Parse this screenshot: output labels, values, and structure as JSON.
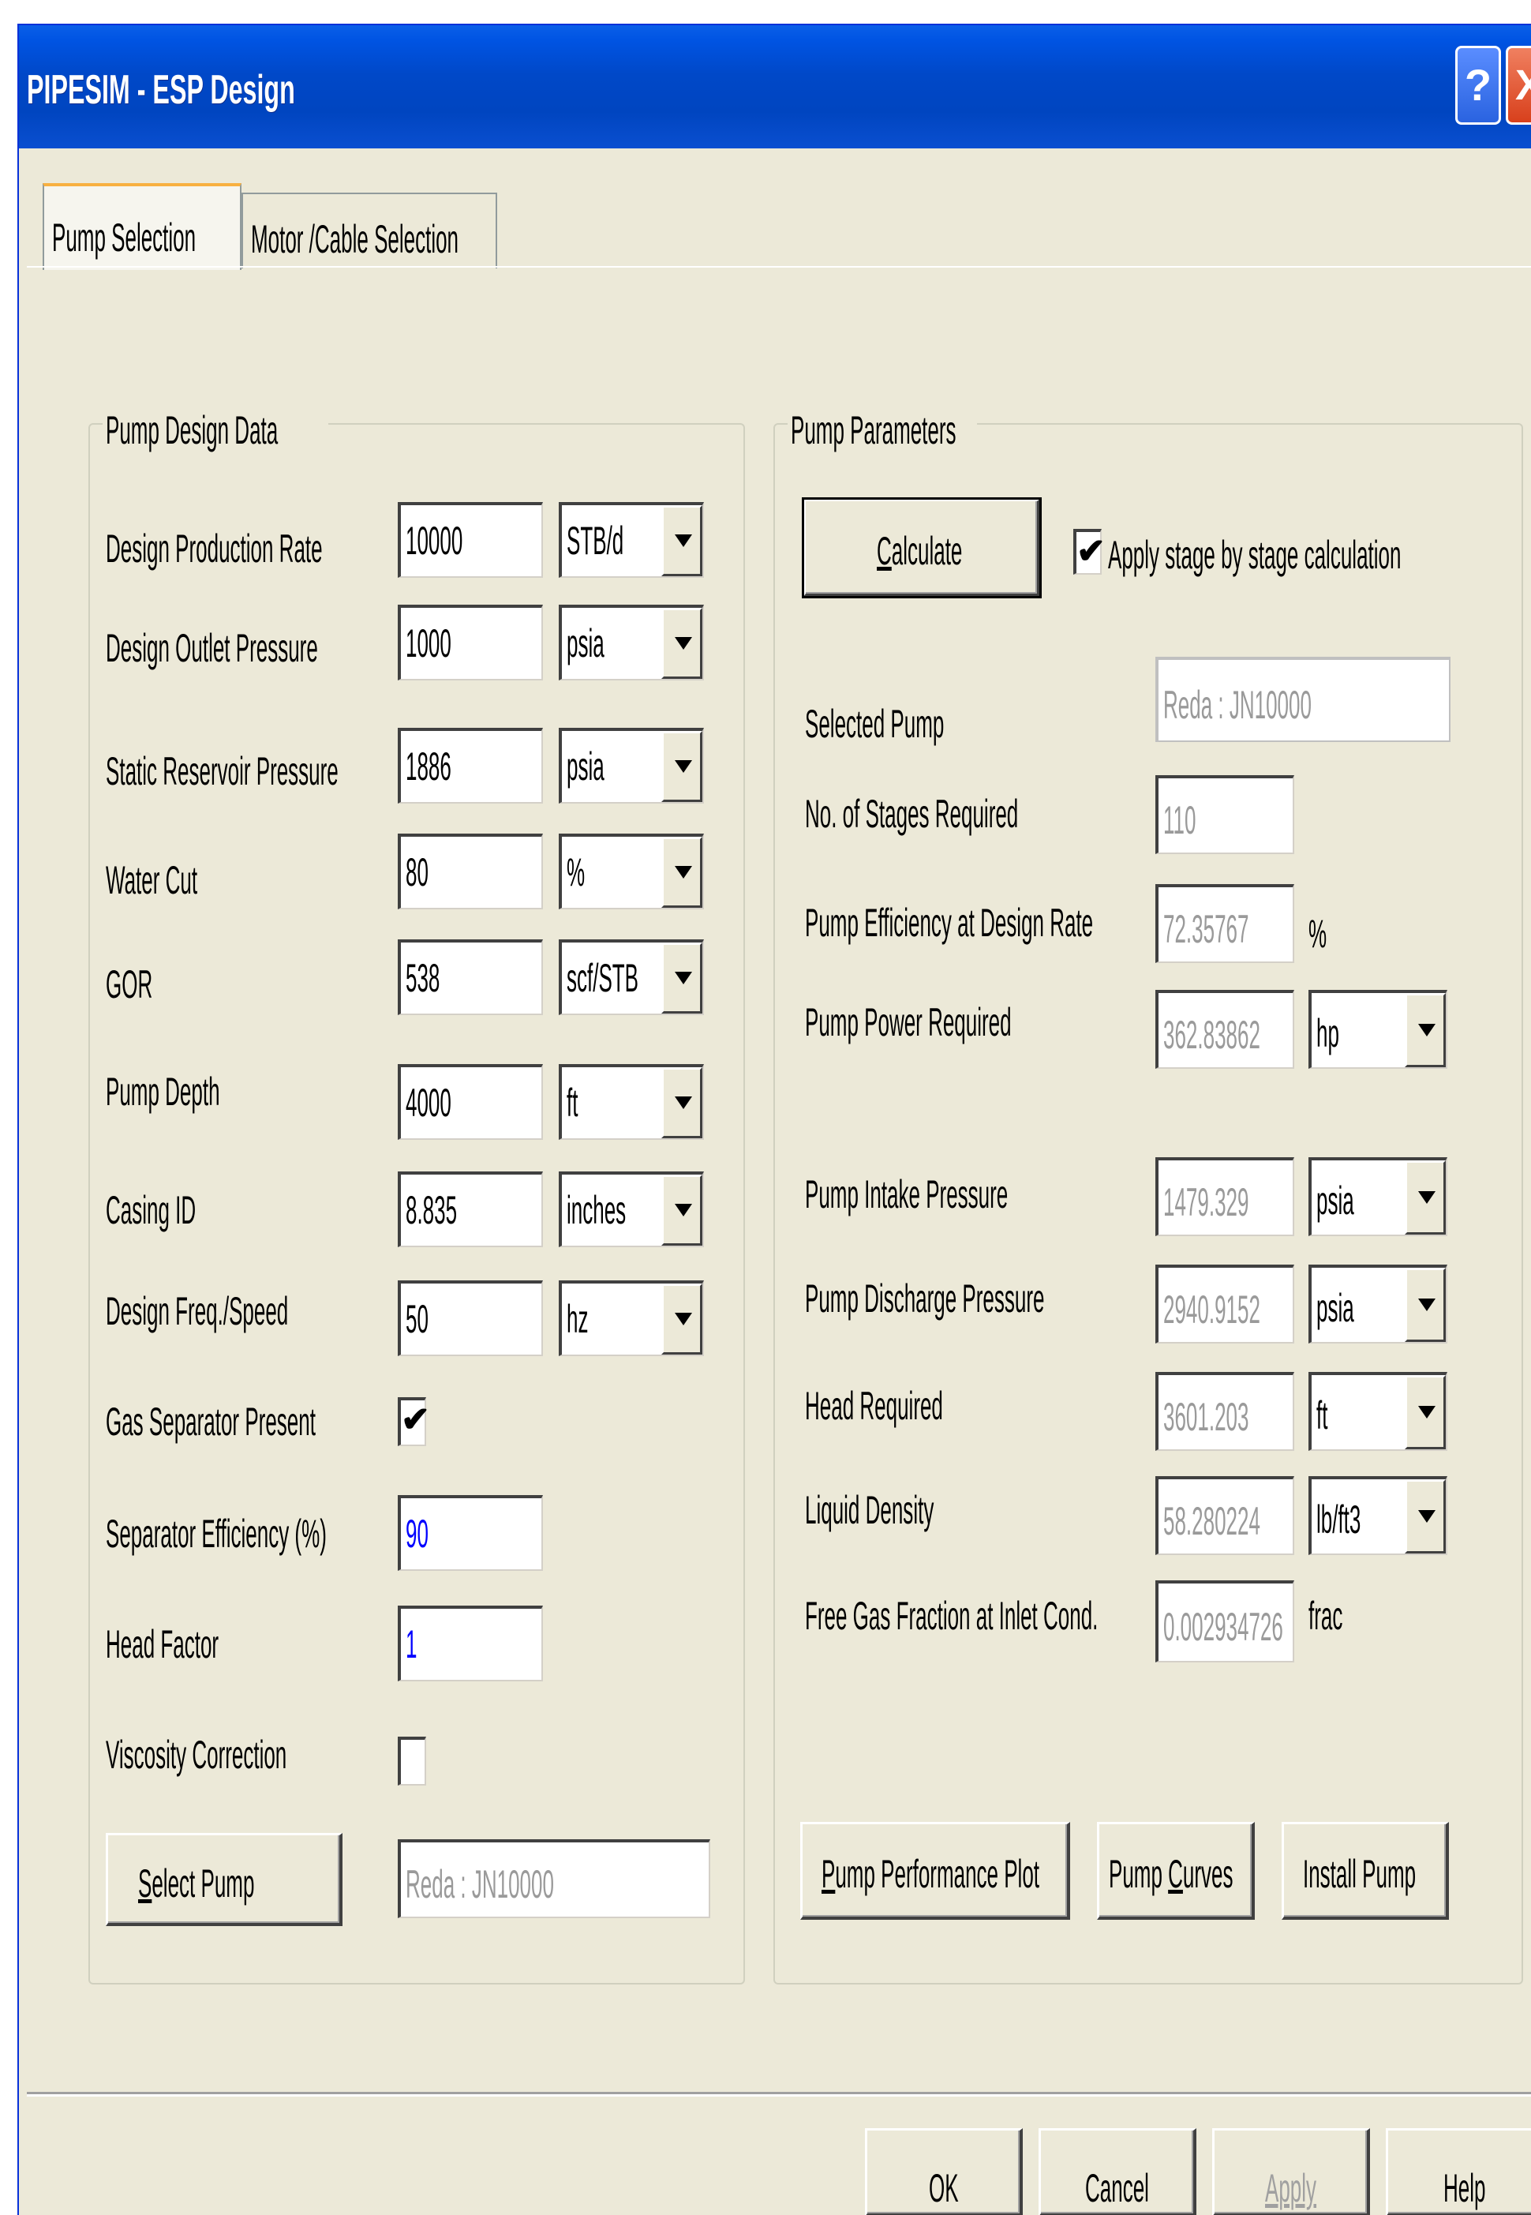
{
  "window": {
    "title": "PIPESIM - ESP Design",
    "help_glyph": "?",
    "close_glyph": "X"
  },
  "tabs": [
    {
      "label": "Pump Selection",
      "active": true
    },
    {
      "label": "Motor /Cable Selection",
      "active": false
    }
  ],
  "design_group": {
    "title": "Pump Design Data",
    "rows": [
      {
        "label": "Design Production Rate",
        "value": "10000",
        "unit": "STB/d"
      },
      {
        "label": "Design Outlet Pressure",
        "value": "1000",
        "unit": "psia"
      },
      {
        "label": "Static Reservoir Pressure",
        "value": "1886",
        "unit": "psia"
      },
      {
        "label": "Water Cut",
        "value": "80",
        "unit": "%"
      },
      {
        "label": "GOR",
        "value": "538",
        "unit": "scf/STB"
      },
      {
        "label": "Pump Depth",
        "value": "4000",
        "unit": "ft"
      },
      {
        "label": "Casing ID",
        "value": "8.835",
        "unit": "inches"
      },
      {
        "label": "Design Freq./Speed",
        "value": "50",
        "unit": "hz"
      }
    ],
    "gas_separator": {
      "label": "Gas Separator Present",
      "checked": true,
      "mark": "✔"
    },
    "separator_efficiency": {
      "label": "Separator Efficiency (%)",
      "value": "90"
    },
    "head_factor": {
      "label": "Head Factor",
      "value": "1"
    },
    "viscosity_correction": {
      "label": "Viscosity Correction",
      "checked": false
    },
    "select_pump_button": {
      "pre": "",
      "accel": "S",
      "post": "elect Pump"
    },
    "selected_pump_value": "Reda : JN10000"
  },
  "params_group": {
    "title": "Pump Parameters",
    "calculate_button": {
      "accel": "C",
      "post": "alculate"
    },
    "stage_by_stage": {
      "label": "Apply stage by stage calculation",
      "checked": true,
      "mark": "✔"
    },
    "selected_pump": {
      "label": "Selected Pump",
      "value": "Reda : JN10000"
    },
    "stages": {
      "label": "No. of Stages Required",
      "value": "110"
    },
    "efficiency": {
      "label": "Pump Efficiency at Design Rate",
      "value": "72.35767",
      "unit": "%"
    },
    "power": {
      "label": "Pump Power Required",
      "value": "362.83862",
      "unit": "hp"
    },
    "intake_pressure": {
      "label": "Pump Intake Pressure",
      "value": "1479.329",
      "unit": "psia"
    },
    "discharge_pressure": {
      "label": "Pump Discharge Pressure",
      "value": "2940.9152",
      "unit": "psia"
    },
    "head_required": {
      "label": "Head Required",
      "value": "3601.203",
      "unit": "ft"
    },
    "liquid_density": {
      "label": "Liquid Density",
      "value": "58.280224",
      "unit": "lb/ft3"
    },
    "free_gas": {
      "label": "Free Gas Fraction at Inlet Cond.",
      "value": "0.002934726",
      "unit": "frac"
    },
    "performance_plot_button": {
      "accel": "P",
      "post": "ump Performance Plot"
    },
    "pump_curves_button": {
      "pre": "Pump ",
      "accel": "C",
      "post": "urves"
    },
    "install_pump_button": "Install Pump"
  },
  "footer": {
    "ok": "OK",
    "cancel": "Cancel",
    "apply": "Apply",
    "help": "Help"
  }
}
